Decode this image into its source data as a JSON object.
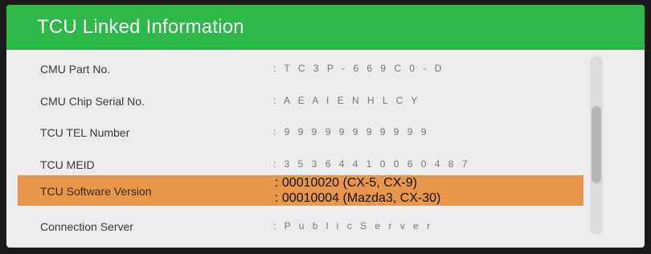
{
  "header": {
    "title": "TCU Linked Information"
  },
  "rows": [
    {
      "label": "CMU Part No.",
      "value": ": T C 3 P - 6 6 9 C 0 - D"
    },
    {
      "label": "CMU Chip Serial No.",
      "value": ": A E A I E N H L C Y"
    },
    {
      "label": "TCU TEL Number",
      "value": ": 9 9 9 9 9 9 9 9 9 9 9"
    },
    {
      "label": "TCU MEID",
      "value": ": 3 5 3 6 4 4 1 0 0 6 0 4 8 7"
    },
    {
      "label": "TCU Software Version",
      "value_lines": [
        ": 00010020 (CX-5, CX-9)",
        ": 00010004 (Mazda3, CX-30)"
      ]
    },
    {
      "label": "Connection Server",
      "value": ": P u b l i c   S e r v e r"
    }
  ]
}
